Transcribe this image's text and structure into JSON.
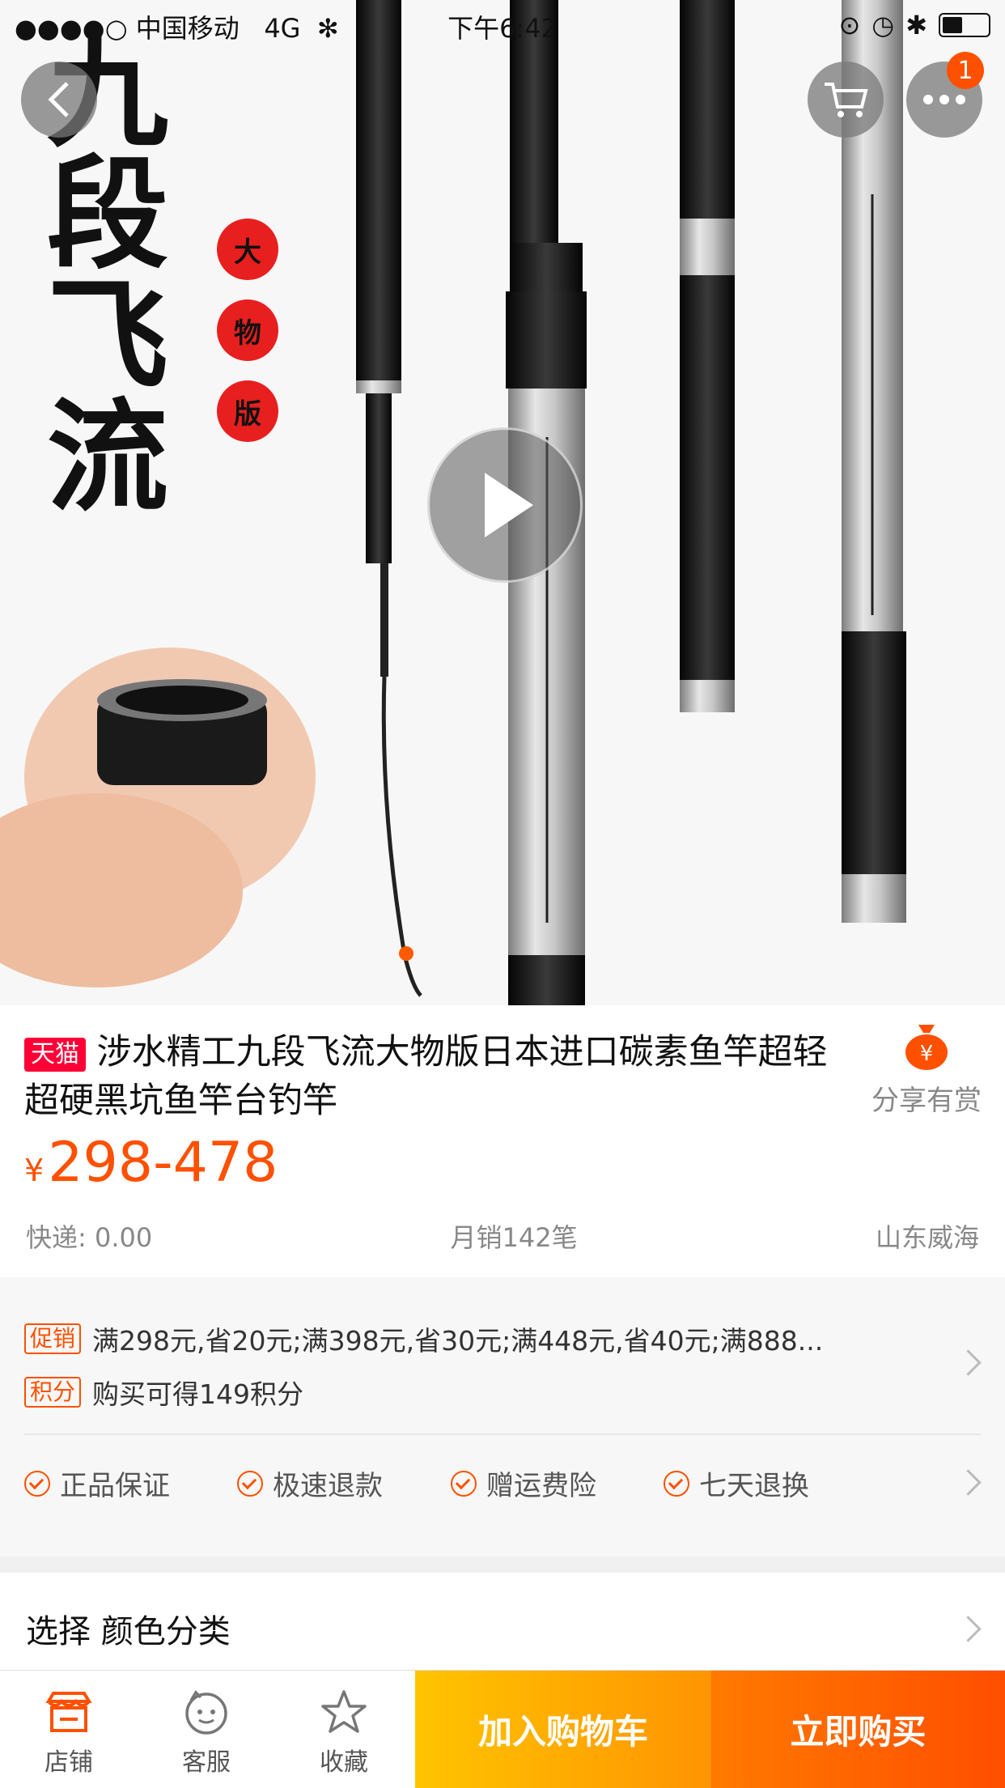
{
  "status_bar": {
    "carrier": "●●●●○ 中国移动",
    "network": "4G",
    "time": "下午6:42"
  },
  "header": {
    "back_icon": "chevron-left-icon",
    "cart_icon": "cart-icon",
    "more_icon": "more-icon",
    "more_badge": "1"
  },
  "hero": {
    "calligraphy": "九段飞流",
    "seals": [
      "大",
      "物",
      "版"
    ],
    "play_icon": "play-icon"
  },
  "product": {
    "tag": "天猫",
    "title": "涉水精工九段飞流大物版日本进口碳素鱼竿超轻超硬黑坑鱼竿台钓竿",
    "share_label": "分享有赏",
    "currency": "¥",
    "price": "298-478",
    "shipping": "快递: 0.00",
    "monthly_sales": "月销142笔",
    "location": "山东威海"
  },
  "promo": {
    "promo_tag": "促销",
    "promo_text": "满298元,省20元;满398元,省30元;满448元,省40元;满888...",
    "points_tag": "积分",
    "points_text": "购买可得149积分",
    "guarantees": [
      "正品保证",
      "极速退款",
      "赠运费险",
      "七天退换"
    ]
  },
  "select": {
    "label": "选择  颜色分类"
  },
  "bottom_bar": {
    "shop": "店铺",
    "service": "客服",
    "favorite": "收藏",
    "add_to_cart": "加入购物车",
    "buy_now": "立即购买"
  },
  "colors": {
    "accent": "#ff5000",
    "tmall": "#ff0036",
    "cart_button": "#ffa400",
    "buy_button": "#ff5a00"
  }
}
